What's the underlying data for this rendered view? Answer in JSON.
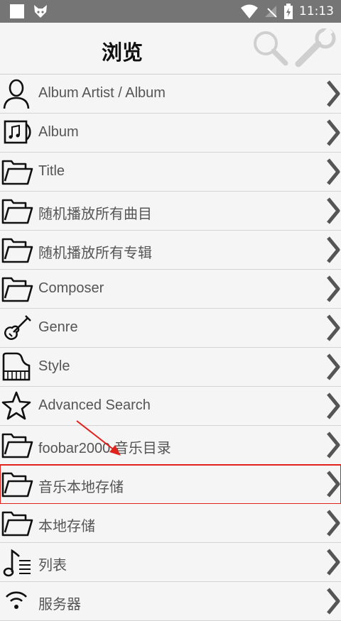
{
  "status_bar": {
    "time": "11:13",
    "icons": [
      "app-square-icon",
      "fox-icon",
      "wifi-icon",
      "no-sim-icon",
      "battery-charging-icon"
    ]
  },
  "header": {
    "title": "浏览",
    "search_icon": "search-icon",
    "settings_icon": "wrench-icon"
  },
  "browse_items": [
    {
      "label": "Album Artist / Album",
      "icon": "person-icon"
    },
    {
      "label": "Album",
      "icon": "album-icon"
    },
    {
      "label": "Title",
      "icon": "folder-icon"
    },
    {
      "label": "随机播放所有曲目",
      "icon": "folder-icon"
    },
    {
      "label": "随机播放所有专辑",
      "icon": "folder-icon"
    },
    {
      "label": "Composer",
      "icon": "folder-icon"
    },
    {
      "label": "Genre",
      "icon": "violin-icon"
    },
    {
      "label": "Style",
      "icon": "piano-icon"
    },
    {
      "label": "Advanced Search",
      "icon": "star-icon"
    },
    {
      "label": "foobar2000 音乐目录",
      "icon": "folder-icon"
    },
    {
      "label": "音乐本地存储",
      "icon": "folder-icon",
      "highlighted": true
    },
    {
      "label": "本地存储",
      "icon": "folder-icon"
    },
    {
      "label": "列表",
      "icon": "music-list-icon"
    },
    {
      "label": "服务器",
      "icon": "broadcast-icon"
    }
  ],
  "colors": {
    "status_bar": "#757575",
    "background": "#f5f5f5",
    "divider": "#d4d4d4",
    "label_text": "#555555",
    "highlight": "#e0221c",
    "chevron": "#555555"
  }
}
